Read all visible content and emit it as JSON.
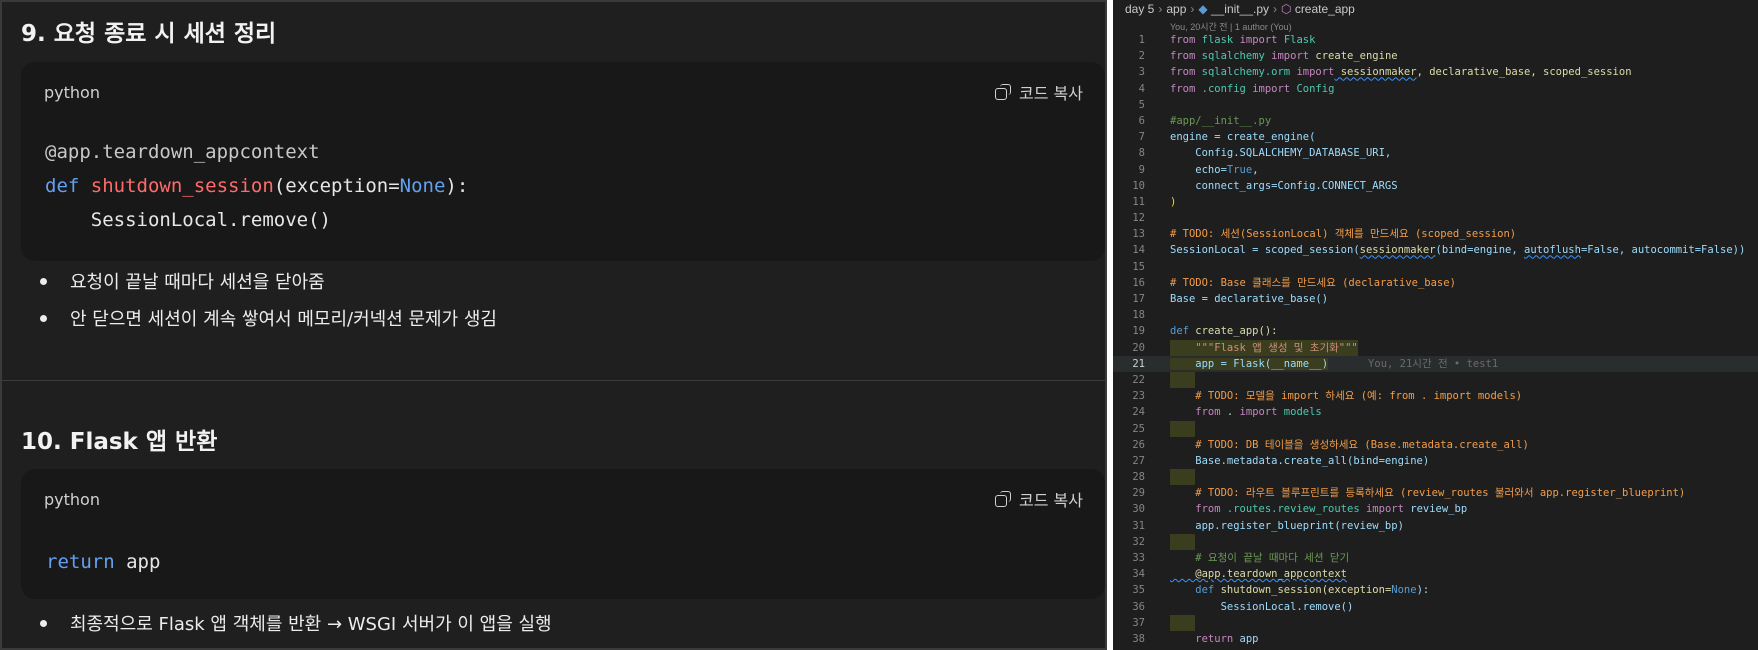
{
  "left": {
    "section9": {
      "title": "9. 요청 종료 시 세션 정리",
      "lang": "python",
      "copy_label": "코드 복사",
      "code_line1": "@app.teardown_appcontext",
      "code_def": "def",
      "code_fn": "shutdown_session",
      "code_args1": "(exception=",
      "code_none": "None",
      "code_args2": "):",
      "code_line3": "    SessionLocal.remove()",
      "bullets": [
        "요청이 끝날 때마다 세션을 닫아줌",
        "안 닫으면 세션이 계속 쌓여서 메모리/커넥션 문제가 생김"
      ]
    },
    "section10": {
      "title": "10. Flask 앱 반환",
      "lang": "python",
      "copy_label": "코드 복사",
      "code_return": "return",
      "code_app": " app",
      "bullets": [
        "최종적으로 Flask 앱 객체를 반환 → WSGI 서버가 이 앱을 실행"
      ]
    }
  },
  "editor": {
    "breadcrumb": {
      "folder": "day 5",
      "subfolder": "app",
      "file": "__init__.py",
      "symbol": "create_app"
    },
    "blame_header": "You, 20시간 전 | 1 author (You)",
    "inline_blame": "You, 21시간 전 • test1",
    "current_line": 21,
    "colors": {
      "keyword": "#569cd6",
      "string": "#ce9178",
      "comment": "#6a9955",
      "todo": "#f29d4a"
    },
    "lines": [
      "1",
      "2",
      "3",
      "4",
      "5",
      "6",
      "7",
      "8",
      "9",
      "10",
      "11",
      "12",
      "13",
      "14",
      "15",
      "16",
      "17",
      "18",
      "19",
      "20",
      "21",
      "22",
      "23",
      "24",
      "25",
      "26",
      "27",
      "28",
      "29",
      "30",
      "31",
      "32",
      "33",
      "34",
      "35",
      "36",
      "37",
      "38"
    ],
    "code": {
      "l1a": "from",
      "l1b": " flask ",
      "l1c": "import",
      "l1d": " Flask",
      "l2a": "from",
      "l2b": " sqlalchemy ",
      "l2c": "import",
      "l2d": " create_engine",
      "l3a": "from",
      "l3b": " sqlalchemy.orm ",
      "l3c": "import",
      "l3d": " sessionmaker",
      ", ": "",
      "l3e": ", declarative_base, scoped_session",
      "l4a": "from",
      "l4b": " .config ",
      "l4c": "import",
      "l4d": " Config",
      "l6": "#app/__init__.py",
      "l7": "engine = create_engine(",
      "l8": "    Config.SQLALCHEMY_DATABASE_URI,",
      "l9a": "    echo=",
      "l9b": "True",
      ",": ",",
      "l10": "    connect_args=Config.CONNECT_ARGS",
      "l11": ")",
      "l13": "# TODO: 세션(SessionLocal) 객체를 만드세요 (scoped_session)",
      "l14a": "SessionLocal = scoped_session(",
      "l14b": "sessionmaker",
      "l14c": "(bind=engine, ",
      "l14d": "autoflush",
      "l14e": "=False, autocommit=False))",
      "l16": "# TODO: Base 클래스를 만드세요 (declarative_base)",
      "l17": "Base = declarative_base()",
      "l19a": "def",
      "l19b": " create_app():",
      "l20": "    \"\"\"Flask 앱 생성 및 초기화\"\"\"",
      "l21": "    app = Flask(__name__)",
      "l23": "    # TODO: 모델을 import 하세요 (예: from . import models)",
      "l24a": "    from",
      " . ": "",
      "l24b": " . ",
      "l24c": "import",
      "l24d": " models",
      "l26": "    # TODO: DB 테이블을 생성하세요 (Base.metadata.create_all)",
      "l27": "    Base.metadata.create_all(bind=engine)",
      "l29": "    # TODO: 라우트 블루프린트를 등록하세요 (review_routes 불러와서 app.register_blueprint)",
      "l30a": "    from",
      "l30b": " .routes.review_routes ",
      "l30c": "import",
      "l30d": " review_bp",
      "l31": "    app.register_blueprint(review_bp)",
      "l33": "    # 요청이 끝날 때마다 세션 닫기",
      "l34": "    @app.teardown_appcontext",
      "l35a": "    def",
      "l35b": " shutdown_session(exception=",
      "l35c": "None",
      "l35d": "):",
      "l36": "        SessionLocal.remove()",
      "l38a": "    return",
      "l38b": " app"
    }
  }
}
